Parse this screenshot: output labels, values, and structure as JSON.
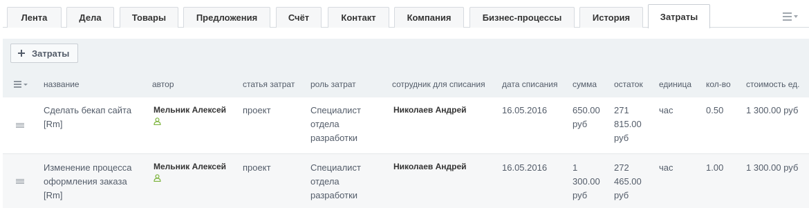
{
  "tabs": {
    "items": [
      "Лента",
      "Дела",
      "Товары",
      "Предложения",
      "Счёт",
      "Контакт",
      "Компания",
      "Бизнес-процессы",
      "История",
      "Затраты"
    ],
    "active": "Затраты"
  },
  "toolbar": {
    "add_label": "Затраты"
  },
  "grid": {
    "headers": {
      "name": "название",
      "author": "автор",
      "expense_item": "статья затрат",
      "expense_role": "роль затрат",
      "employee": "сотрудник для списания",
      "date": "дата списания",
      "amount": "сумма",
      "balance": "остаток",
      "unit": "единица",
      "qty": "кол-во",
      "unit_cost": "стоимость ед."
    },
    "rows": [
      {
        "name": [
          "Сделать бекап сайта",
          "[Rm]"
        ],
        "author": "Мельник Алексей",
        "expense_item": "проект",
        "expense_role": [
          "Специалист",
          "отдела",
          "разработки"
        ],
        "employee": "Николаев Андрей",
        "date": "16.05.2016",
        "amount": [
          "650.00",
          "руб"
        ],
        "balance": [
          "271",
          "815.00",
          "руб"
        ],
        "unit": "час",
        "qty": "0.50",
        "unit_cost": "1 300.00 руб"
      },
      {
        "name": [
          "Изменение процесса",
          "оформления заказа",
          "[Rm]"
        ],
        "author": "Мельник Алексей",
        "expense_item": "проект",
        "expense_role": [
          "Специалист",
          "отдела",
          "разработки"
        ],
        "employee": "Николаев Андрей",
        "date": "16.05.2016",
        "amount": [
          "1",
          "300.00",
          "руб"
        ],
        "balance": [
          "272",
          "465.00",
          "руб"
        ],
        "unit": "час",
        "qty": "1.00",
        "unit_cost": "1 300.00 руб"
      }
    ]
  },
  "colors": {
    "accent_green": "#7bb33a",
    "header_bg": "#eef2f4",
    "text": "#535c69"
  },
  "icons": {
    "tabs_menu": "menu-icon",
    "settings": "settings-menu-icon",
    "drag": "drag-handle-icon",
    "user": "user-icon",
    "add": "plus-icon"
  }
}
